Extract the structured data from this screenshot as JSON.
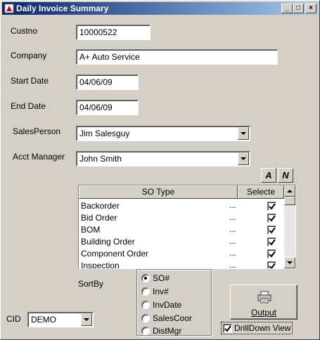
{
  "window": {
    "title": "Daily Invoice Summary",
    "controls": {
      "minimize": "_",
      "maximize": "□",
      "close": "×"
    }
  },
  "form": {
    "custno": {
      "label": "Custno",
      "value": "10000522"
    },
    "company": {
      "label": "Company",
      "value": "A+ Auto Service"
    },
    "start_date": {
      "label": "Start Date",
      "value": "04/06/09"
    },
    "end_date": {
      "label": "End Date",
      "value": "04/06/09"
    },
    "salesperson": {
      "label": "SalesPerson",
      "value": "Jim Salesguy"
    },
    "acct_manager": {
      "label": "Acct Manager",
      "value": "John Smith"
    }
  },
  "toolbar": {
    "all_label": "A",
    "none_label": "N"
  },
  "so_grid": {
    "columns": [
      "SO Type",
      "Selecte"
    ],
    "rows": [
      {
        "name": "Backorder",
        "ellipsis": "...",
        "selected": true
      },
      {
        "name": "Bid Order",
        "ellipsis": "...",
        "selected": true
      },
      {
        "name": "BOM",
        "ellipsis": "...",
        "selected": true
      },
      {
        "name": "Building Order",
        "ellipsis": "...",
        "selected": true
      },
      {
        "name": "Component Order",
        "ellipsis": "...",
        "selected": true
      },
      {
        "name": "Inspection",
        "ellipsis": "...",
        "selected": true
      }
    ]
  },
  "sortby": {
    "label": "SortBy",
    "options": [
      "SO#",
      "Inv#",
      "InvDate",
      "SalesCoor",
      "DistMgr"
    ],
    "selected": "SO#"
  },
  "cid": {
    "label": "CID",
    "value": "DEMO"
  },
  "output_button": {
    "label": "Output",
    "icon": "printer-icon"
  },
  "drilldown": {
    "label": "DrillDown View",
    "checked": true
  },
  "icons": {
    "app": "app-icon",
    "dropdown": "chevron-down-icon",
    "scroll_up": "arrow-up-icon",
    "scroll_down": "arrow-down-icon"
  }
}
